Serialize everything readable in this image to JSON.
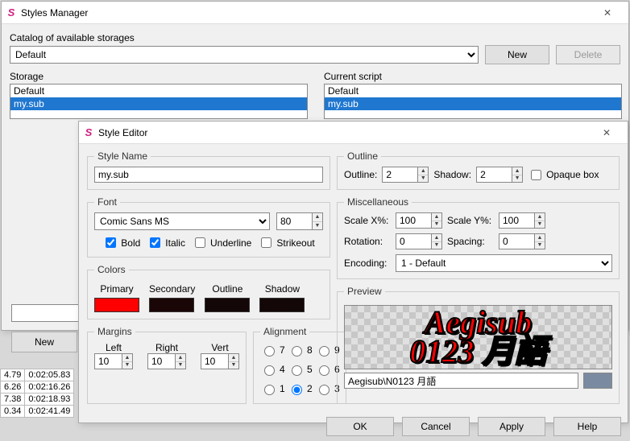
{
  "styles_manager": {
    "title": "Styles Manager",
    "catalog_label": "Catalog of available storages",
    "catalog_selected": "Default",
    "new_btn": "New",
    "delete_btn": "Delete",
    "storage_label": "Storage",
    "storage_items": [
      "Default",
      "my.sub"
    ],
    "current_label": "Current script",
    "current_items": [
      "Default",
      "my.sub"
    ],
    "storage_new_btn": "New"
  },
  "style_editor": {
    "title": "Style Editor",
    "style_name": {
      "legend": "Style Name",
      "value": "my.sub"
    },
    "font": {
      "legend": "Font",
      "family": "Comic Sans MS",
      "size": "80",
      "bold_label": "Bold",
      "bold": true,
      "italic_label": "Italic",
      "italic": true,
      "underline_label": "Underline",
      "underline": false,
      "strikeout_label": "Strikeout",
      "strikeout": false
    },
    "colors": {
      "legend": "Colors",
      "primary_label": "Primary",
      "primary": "#ff0000",
      "secondary_label": "Secondary",
      "secondary": "#1a0606",
      "outline_label": "Outline",
      "outline": "#140707",
      "shadow_label": "Shadow",
      "shadow": "#130707"
    },
    "margins": {
      "legend": "Margins",
      "left_label": "Left",
      "left": "10",
      "right_label": "Right",
      "right": "10",
      "vert_label": "Vert",
      "vert": "10"
    },
    "alignment": {
      "legend": "Alignment",
      "value": "2"
    },
    "outline": {
      "legend": "Outline",
      "outline_label": "Outline:",
      "outline": "2",
      "shadow_label": "Shadow:",
      "shadow": "2",
      "opaque_label": "Opaque box",
      "opaque": false
    },
    "misc": {
      "legend": "Miscellaneous",
      "scalex_label": "Scale X%:",
      "scalex": "100",
      "scaley_label": "Scale Y%:",
      "scaley": "100",
      "rotation_label": "Rotation:",
      "rotation": "0",
      "spacing_label": "Spacing:",
      "spacing": "0",
      "encoding_label": "Encoding:",
      "encoding": "1 - Default"
    },
    "preview": {
      "legend": "Preview",
      "line1": "Aegisub",
      "line2": "0123 月語",
      "text_value": "Aegisub\\N0123 月語",
      "swatch": "#7a8aa0"
    },
    "buttons": {
      "ok": "OK",
      "cancel": "Cancel",
      "apply": "Apply",
      "help": "Help"
    }
  },
  "timeline": {
    "rows": [
      [
        "4.79",
        "0:02:05.83"
      ],
      [
        "6.26",
        "0:02:16.26"
      ],
      [
        "7.38",
        "0:02:18.93"
      ],
      [
        "0.34",
        "0:02:41.49"
      ]
    ]
  }
}
